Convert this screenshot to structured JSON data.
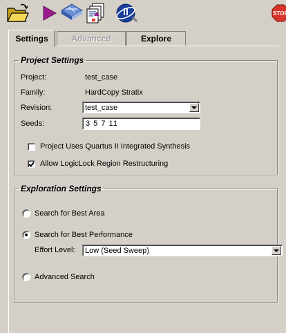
{
  "toolbar": {
    "icons": [
      "open-folder-icon",
      "run-icon",
      "compile-icon",
      "report-icon",
      "quartus-ii-icon",
      "stop-icon"
    ],
    "stop_label": "STOP",
    "colors": {
      "run": "#9b1b8f",
      "stop": "#d9342b"
    }
  },
  "tabs": [
    {
      "label": "Settings",
      "state": "active"
    },
    {
      "label": "Advanced",
      "state": "disabled"
    },
    {
      "label": "Explore",
      "state": "normal"
    }
  ],
  "project_settings": {
    "legend": "Project Settings",
    "project_label": "Project:",
    "project_value": "test_case",
    "family_label": "Family:",
    "family_value": "HardCopy Stratix",
    "revision_label": "Revision:",
    "revision_value": "test_case",
    "seeds_label": "Seeds:",
    "seeds_value": "3 5 7 11",
    "integrated_synthesis_label": "Project Uses Quartus II Integrated Synthesis",
    "integrated_synthesis_checked": false,
    "logiclock_label": "Allow LogicLock Region Restructuring",
    "logiclock_checked": true
  },
  "exploration_settings": {
    "legend": "Exploration Settings",
    "best_area_label": "Search for Best Area",
    "best_performance_label": "Search for Best Performance",
    "effort_label": "Effort Level:",
    "effort_value": "Low (Seed Sweep)",
    "advanced_search_label": "Advanced Search",
    "selected": "best_performance"
  }
}
